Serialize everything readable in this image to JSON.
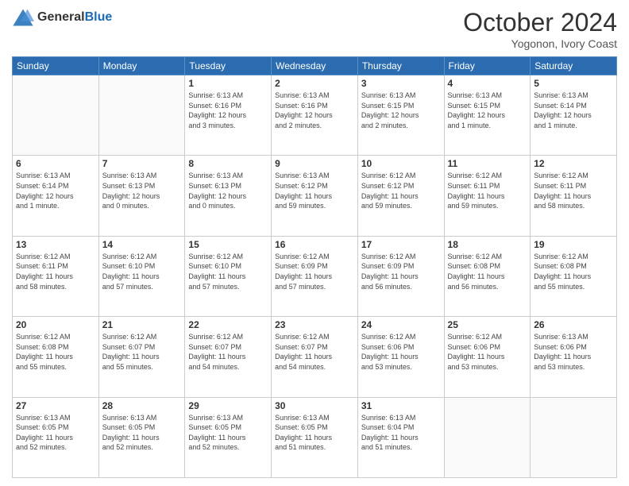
{
  "header": {
    "logo_line1": "General",
    "logo_line2": "Blue",
    "month": "October 2024",
    "location": "Yogonon, Ivory Coast"
  },
  "weekdays": [
    "Sunday",
    "Monday",
    "Tuesday",
    "Wednesday",
    "Thursday",
    "Friday",
    "Saturday"
  ],
  "weeks": [
    [
      {
        "day": "",
        "info": ""
      },
      {
        "day": "",
        "info": ""
      },
      {
        "day": "1",
        "info": "Sunrise: 6:13 AM\nSunset: 6:16 PM\nDaylight: 12 hours\nand 3 minutes."
      },
      {
        "day": "2",
        "info": "Sunrise: 6:13 AM\nSunset: 6:16 PM\nDaylight: 12 hours\nand 2 minutes."
      },
      {
        "day": "3",
        "info": "Sunrise: 6:13 AM\nSunset: 6:15 PM\nDaylight: 12 hours\nand 2 minutes."
      },
      {
        "day": "4",
        "info": "Sunrise: 6:13 AM\nSunset: 6:15 PM\nDaylight: 12 hours\nand 1 minute."
      },
      {
        "day": "5",
        "info": "Sunrise: 6:13 AM\nSunset: 6:14 PM\nDaylight: 12 hours\nand 1 minute."
      }
    ],
    [
      {
        "day": "6",
        "info": "Sunrise: 6:13 AM\nSunset: 6:14 PM\nDaylight: 12 hours\nand 1 minute."
      },
      {
        "day": "7",
        "info": "Sunrise: 6:13 AM\nSunset: 6:13 PM\nDaylight: 12 hours\nand 0 minutes."
      },
      {
        "day": "8",
        "info": "Sunrise: 6:13 AM\nSunset: 6:13 PM\nDaylight: 12 hours\nand 0 minutes."
      },
      {
        "day": "9",
        "info": "Sunrise: 6:13 AM\nSunset: 6:12 PM\nDaylight: 11 hours\nand 59 minutes."
      },
      {
        "day": "10",
        "info": "Sunrise: 6:12 AM\nSunset: 6:12 PM\nDaylight: 11 hours\nand 59 minutes."
      },
      {
        "day": "11",
        "info": "Sunrise: 6:12 AM\nSunset: 6:11 PM\nDaylight: 11 hours\nand 59 minutes."
      },
      {
        "day": "12",
        "info": "Sunrise: 6:12 AM\nSunset: 6:11 PM\nDaylight: 11 hours\nand 58 minutes."
      }
    ],
    [
      {
        "day": "13",
        "info": "Sunrise: 6:12 AM\nSunset: 6:11 PM\nDaylight: 11 hours\nand 58 minutes."
      },
      {
        "day": "14",
        "info": "Sunrise: 6:12 AM\nSunset: 6:10 PM\nDaylight: 11 hours\nand 57 minutes."
      },
      {
        "day": "15",
        "info": "Sunrise: 6:12 AM\nSunset: 6:10 PM\nDaylight: 11 hours\nand 57 minutes."
      },
      {
        "day": "16",
        "info": "Sunrise: 6:12 AM\nSunset: 6:09 PM\nDaylight: 11 hours\nand 57 minutes."
      },
      {
        "day": "17",
        "info": "Sunrise: 6:12 AM\nSunset: 6:09 PM\nDaylight: 11 hours\nand 56 minutes."
      },
      {
        "day": "18",
        "info": "Sunrise: 6:12 AM\nSunset: 6:08 PM\nDaylight: 11 hours\nand 56 minutes."
      },
      {
        "day": "19",
        "info": "Sunrise: 6:12 AM\nSunset: 6:08 PM\nDaylight: 11 hours\nand 55 minutes."
      }
    ],
    [
      {
        "day": "20",
        "info": "Sunrise: 6:12 AM\nSunset: 6:08 PM\nDaylight: 11 hours\nand 55 minutes."
      },
      {
        "day": "21",
        "info": "Sunrise: 6:12 AM\nSunset: 6:07 PM\nDaylight: 11 hours\nand 55 minutes."
      },
      {
        "day": "22",
        "info": "Sunrise: 6:12 AM\nSunset: 6:07 PM\nDaylight: 11 hours\nand 54 minutes."
      },
      {
        "day": "23",
        "info": "Sunrise: 6:12 AM\nSunset: 6:07 PM\nDaylight: 11 hours\nand 54 minutes."
      },
      {
        "day": "24",
        "info": "Sunrise: 6:12 AM\nSunset: 6:06 PM\nDaylight: 11 hours\nand 53 minutes."
      },
      {
        "day": "25",
        "info": "Sunrise: 6:12 AM\nSunset: 6:06 PM\nDaylight: 11 hours\nand 53 minutes."
      },
      {
        "day": "26",
        "info": "Sunrise: 6:13 AM\nSunset: 6:06 PM\nDaylight: 11 hours\nand 53 minutes."
      }
    ],
    [
      {
        "day": "27",
        "info": "Sunrise: 6:13 AM\nSunset: 6:05 PM\nDaylight: 11 hours\nand 52 minutes."
      },
      {
        "day": "28",
        "info": "Sunrise: 6:13 AM\nSunset: 6:05 PM\nDaylight: 11 hours\nand 52 minutes."
      },
      {
        "day": "29",
        "info": "Sunrise: 6:13 AM\nSunset: 6:05 PM\nDaylight: 11 hours\nand 52 minutes."
      },
      {
        "day": "30",
        "info": "Sunrise: 6:13 AM\nSunset: 6:05 PM\nDaylight: 11 hours\nand 51 minutes."
      },
      {
        "day": "31",
        "info": "Sunrise: 6:13 AM\nSunset: 6:04 PM\nDaylight: 11 hours\nand 51 minutes."
      },
      {
        "day": "",
        "info": ""
      },
      {
        "day": "",
        "info": ""
      }
    ]
  ]
}
